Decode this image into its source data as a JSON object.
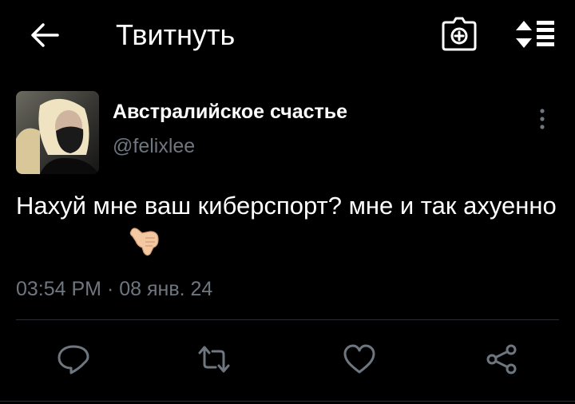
{
  "header": {
    "title": "Твитнуть",
    "back_icon": "arrow-left-icon",
    "camera_icon": "camera-plus-icon",
    "sort_icon": "sort-list-icon"
  },
  "tweet": {
    "display_name": "Австралийское счастье",
    "handle": "@felixlee",
    "text": "Нахуй мне ваш киберспорт? мне и так ахуенно",
    "emoji": "call-me-hand-emoji",
    "timestamp": "03:54 PM · 08 янв. 24"
  },
  "actions": {
    "reply_icon": "reply-icon",
    "retweet_icon": "retweet-icon",
    "like_icon": "heart-icon",
    "share_icon": "share-icon"
  },
  "colors": {
    "background": "#000000",
    "text": "#ffffff",
    "muted": "#6e7680",
    "divider": "#2a2e33"
  }
}
